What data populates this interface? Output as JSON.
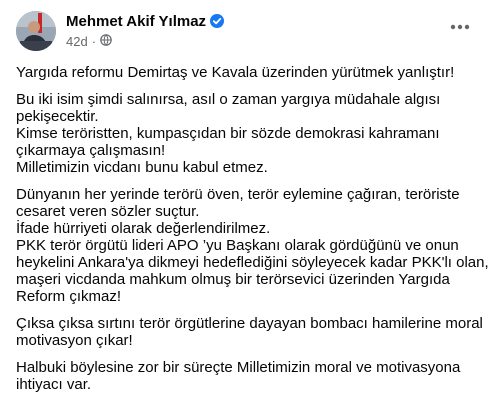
{
  "post": {
    "author": "Mehmet Akif Yılmaz",
    "time": "42d",
    "dot": "·",
    "icons": {
      "verified": "verified-badge-icon",
      "audience": "globe-icon",
      "more": "more-options-icon"
    },
    "colors": {
      "verified": "#1877f2",
      "meta": "#65676b",
      "text": "#050505"
    },
    "paragraphs": [
      [
        "Yargıda reformu Demirtaş ve Kavala üzerinden yürütmek yanlıştır!"
      ],
      [
        "Bu iki isim şimdi salınırsa, asıl o zaman yargıya müdahale algısı",
        "pekişecektir.",
        "Kimse teröristten, kumpasçıdan bir sözde demokrasi kahramanı",
        "çıkarmaya çalışmasın!",
        "Milletimizin vicdanı bunu kabul etmez."
      ],
      [
        "Dünyanın her yerinde terörü öven, terör eylemine çağıran, teröriste",
        "cesaret veren sözler suçtur.",
        "İfade hürriyeti olarak değerlendirilmez.",
        "PKK terör örgütü lideri APO ’yu Başkanı olarak gördüğünü ve onun",
        "heykelini Ankara'ya dikmeyi hedeflediğini söyleyecek kadar PKK'lı olan,",
        "maşeri vicdanda mahkum olmuş bir terörsevici üzerinden Yargıda",
        "Reform çıkmaz!"
      ],
      [
        "Çıksa çıksa sırtını terör örgütlerine dayayan bombacı hamilerine moral",
        "motivasyon çıkar!"
      ],
      [
        "Halbuki böylesine zor bir süreçte Milletimizin moral ve motivasyona",
        "ihtiyacı var."
      ]
    ]
  }
}
